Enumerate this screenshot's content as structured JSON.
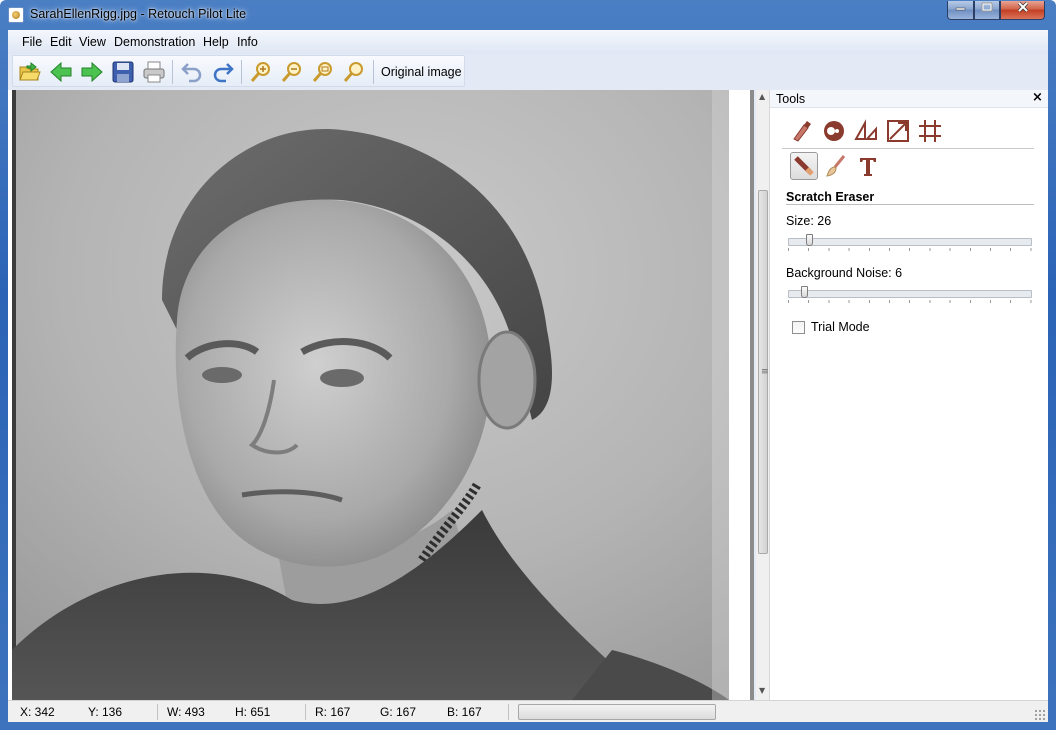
{
  "window": {
    "title": "SarahEllenRigg.jpg - Retouch Pilot Lite"
  },
  "menu": [
    "File",
    "Edit",
    "View",
    "Demonstration",
    "Help",
    "Info"
  ],
  "toolbar": {
    "buttons": [
      "open-icon",
      "back-icon",
      "forward-icon",
      "save-icon",
      "print-icon",
      "undo-icon",
      "redo-icon",
      "zoom-in-icon",
      "zoom-out-icon",
      "zoom-fit-icon",
      "zoom-actual-icon"
    ],
    "original_label": "Original image"
  },
  "tools_panel": {
    "title": "Tools",
    "close": "×",
    "tool_row1": [
      "brush-icon",
      "clone-icon",
      "perspective-icon",
      "resize-icon",
      "crop-icon"
    ],
    "tool_row2": [
      "scratch-eraser-icon",
      "cleaning-brush-icon",
      "text-icon"
    ],
    "active_tool": "scratch-eraser-icon",
    "section_title": "Scratch Eraser",
    "size_label": "Size: 26",
    "size_value": 26,
    "noise_label": "Background Noise: 6",
    "noise_value": 6,
    "trial_mode": "Trial Mode",
    "trial_checked": false
  },
  "status": {
    "x": "X: 342",
    "y": "Y: 136",
    "w": "W: 493",
    "h": "H: 651",
    "r": "R: 167",
    "g": "G: 167",
    "b": "B: 167"
  },
  "colors": {
    "title_bar": "#2b63b6",
    "client": "#e3eaf5",
    "tool_icon": "#8b3a2e"
  }
}
